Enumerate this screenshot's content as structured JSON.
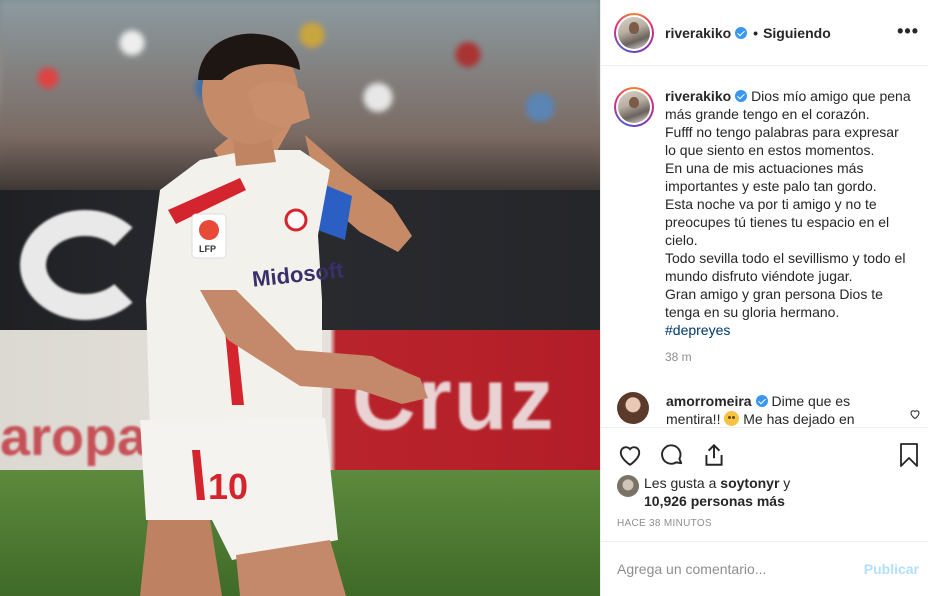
{
  "post": {
    "username": "riverakiko",
    "follow_status": "Siguiendo",
    "separator": "•",
    "more_icon": "more-options-icon",
    "caption_lines": [
      "Dios mío amigo que pena",
      "más grande tengo en el corazón.",
      "Fufff no tengo palabras para expresar",
      "lo que siento en estos momentos.",
      "En una de mis actuaciones más",
      "importantes y este palo tan gordo.",
      "Esta noche va por ti amigo y no te",
      "preocupes tú tienes tu espacio en el",
      "cielo.",
      "Todo sevilla todo el sevillismo y todo el",
      "mundo disfruto viéndote jugar.",
      "Gran amigo y gran persona Dios te",
      "tenga en su gloria hermano."
    ],
    "hashtag": "#depreyes",
    "caption_time": "38 m"
  },
  "comments": [
    {
      "username": "amorromeira",
      "text_line1": "Dime que es",
      "text_line2_a": "mentira!!",
      "text_line2_b": "Me has dejado en"
    }
  ],
  "likes": {
    "prefix": "Les gusta a",
    "user": "soytonyr",
    "conjunction": "y",
    "count_text": "10,926 personas más"
  },
  "posted_ago": "HACE 38 MINUTOS",
  "composer": {
    "placeholder": "Agrega un comentario...",
    "post_label": "Publicar"
  },
  "photo": {
    "shirt_number": "10",
    "sponsor": "Midosoft",
    "badge": "LFP"
  },
  "colors": {
    "verified": "#3897f0",
    "hashtag": "#003569",
    "muted": "#8e8e8e",
    "post_disabled": "#b2dffc"
  }
}
